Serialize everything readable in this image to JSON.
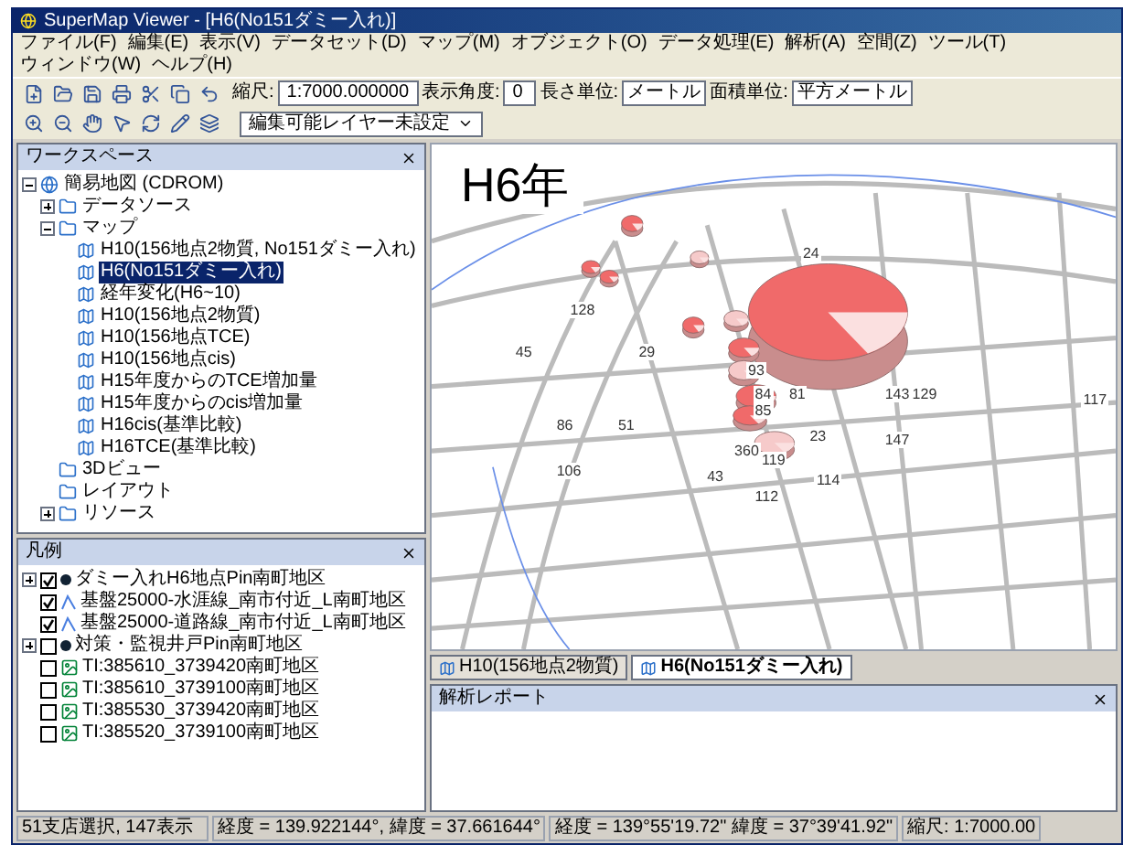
{
  "window": {
    "title": "SuperMap Viewer - [H6(No151ダミー入れ)]"
  },
  "menu": [
    "ファイル(F)",
    "編集(E)",
    "表示(V)",
    "データセット(D)",
    "マップ(M)",
    "オブジェクト(O)",
    "データ処理(E)",
    "解析(A)",
    "空間(Z)",
    "ツール(T)",
    "ウィンドウ(W)",
    "ヘルプ(H)"
  ],
  "toolbar": {
    "scale_label": "縮尺:",
    "scale": "1:7000.000000",
    "angle_label": "表示角度:",
    "angle": "0",
    "length_unit_label": "長さ単位:",
    "length_unit": "メートル",
    "area_unit_label": "面積単位:",
    "area_unit": "平方メートル",
    "layer_select": "編集可能レイヤー未設定"
  },
  "workspace": {
    "title": "ワークスペース",
    "tree": [
      {
        "label": "簡易地図 (CDROM)",
        "expanded": true,
        "children": [
          {
            "label": "データソース",
            "expanded": false
          },
          {
            "label": "マップ",
            "expanded": true,
            "children": [
              {
                "label": "H10(156地点2物質, No151ダミー入れ)",
                "selected": false
              },
              {
                "label": "H6(No151ダミー入れ)",
                "selected": true
              },
              {
                "label": "経年変化(H6~10)",
                "selected": false
              },
              {
                "label": "H10(156地点2物質)",
                "selected": false
              },
              {
                "label": "H10(156地点TCE)",
                "selected": false
              },
              {
                "label": "H10(156地点cis)",
                "selected": false
              },
              {
                "label": "H15年度からのTCE増加量",
                "selected": false
              },
              {
                "label": "H15年度からのcis増加量",
                "selected": false
              },
              {
                "label": "H16cis(基準比較)",
                "selected": false
              },
              {
                "label": "H16TCE(基準比較)",
                "selected": false
              }
            ]
          },
          {
            "label": "3Dビュー"
          },
          {
            "label": "レイアウト"
          },
          {
            "label": "リソース",
            "expanded": false
          }
        ]
      }
    ]
  },
  "legend": {
    "title": "凡例",
    "items": [
      {
        "label": "ダミー入れH6地点Pin南町地区",
        "checked": true,
        "kind": "point",
        "expanded": false
      },
      {
        "label": "基盤25000-水涯線_南市付近_L南町地区",
        "checked": true,
        "kind": "line"
      },
      {
        "label": "基盤25000-道路線_南市付近_L南町地区",
        "checked": true,
        "kind": "line"
      },
      {
        "label": "対策・監視井戸Pin南町地区",
        "checked": false,
        "kind": "point",
        "expanded": false
      },
      {
        "label": "TI:385610_3739420南町地区",
        "checked": false,
        "kind": "image"
      },
      {
        "label": "TI:385610_3739100南町地区",
        "checked": false,
        "kind": "image"
      },
      {
        "label": "TI:385530_3739420南町地区",
        "checked": false,
        "kind": "image"
      },
      {
        "label": "TI:385520_3739100南町地区",
        "checked": false,
        "kind": "image"
      }
    ]
  },
  "map": {
    "title_label": "H6年",
    "point_labels": [
      "24",
      "128",
      "45",
      "29",
      "93",
      "84",
      "81",
      "143",
      "129",
      "117",
      "85",
      "86",
      "51",
      "23",
      "147",
      "360",
      "119",
      "106",
      "43",
      "114",
      "112"
    ]
  },
  "tabs": [
    {
      "label": "H10(156地点2物質)",
      "selected": false
    },
    {
      "label": "H6(No151ダミー入れ)",
      "selected": true
    }
  ],
  "report": {
    "title": "解析レポート"
  },
  "status_bar": [
    "51支店選択, 147表示",
    "経度 = 139.922144°, 緯度 = 37.661644°",
    "経度 = 139°55'19.72\" 緯度 = 37°39'41.92\"",
    "縮尺: 1:7000.00"
  ]
}
